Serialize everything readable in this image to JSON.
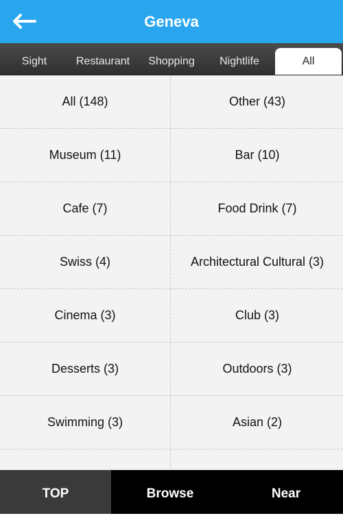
{
  "header": {
    "title": "Geneva",
    "back_icon": "arrow-left-icon"
  },
  "tabs": [
    {
      "label": "Sight"
    },
    {
      "label": "Restaurant"
    },
    {
      "label": "Shopping"
    },
    {
      "label": "Nightlife"
    },
    {
      "label": "All",
      "active": true
    }
  ],
  "categories": [
    [
      "All (148)",
      "Other (43)"
    ],
    [
      "Museum (11)",
      "Bar (10)"
    ],
    [
      "Cafe (7)",
      "Food Drink (7)"
    ],
    [
      "Swiss (4)",
      "Architectural Cultural (3)"
    ],
    [
      "Cinema (3)",
      "Club (3)"
    ],
    [
      "Desserts (3)",
      "Outdoors (3)"
    ],
    [
      "Swimming (3)",
      "Asian (2)"
    ]
  ],
  "bottom_tabs": [
    {
      "label": "TOP",
      "active": true
    },
    {
      "label": "Browse"
    },
    {
      "label": "Near"
    }
  ],
  "colors": {
    "header": "#2aa6ef",
    "tabbar": "#3a3a3a",
    "bottombar": "#000000"
  }
}
